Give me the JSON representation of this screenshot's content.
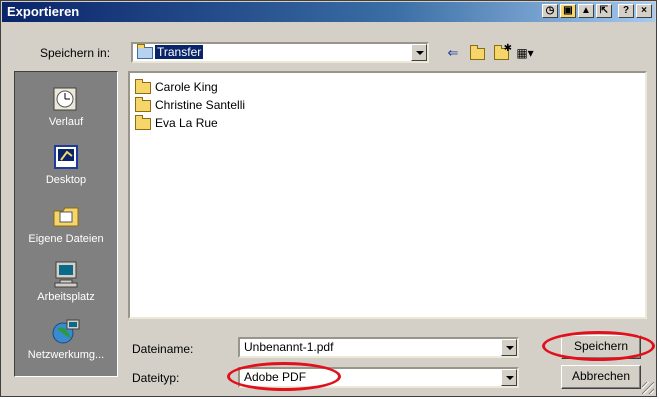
{
  "window": {
    "title": "Exportieren",
    "title_buttons": [
      "?",
      "×"
    ]
  },
  "savein": {
    "label": "Speichern in:",
    "value": "Transfer"
  },
  "places": [
    {
      "label": "Verlauf",
      "icon": "history-icon"
    },
    {
      "label": "Desktop",
      "icon": "desktop-icon"
    },
    {
      "label": "Eigene Dateien",
      "icon": "my-documents-icon"
    },
    {
      "label": "Arbeitsplatz",
      "icon": "my-computer-icon"
    },
    {
      "label": "Netzwerkumg...",
      "icon": "network-icon"
    }
  ],
  "files": [
    {
      "name": "Carole King"
    },
    {
      "name": "Christine Santelli"
    },
    {
      "name": "Eva La Rue"
    }
  ],
  "filename": {
    "label": "Dateiname:",
    "value": "Unbenannt-1.pdf"
  },
  "filetype": {
    "label": "Dateityp:",
    "value": "Adobe PDF"
  },
  "buttons": {
    "save": "Speichern",
    "cancel": "Abbrechen"
  },
  "colors": {
    "titlebar": "#0a246a",
    "highlight_ring": "#e0101c",
    "face": "#d4d0c8"
  }
}
